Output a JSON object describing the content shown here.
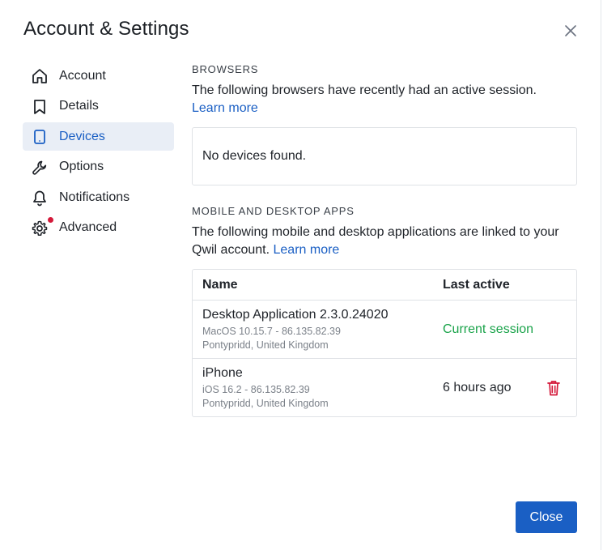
{
  "dialog": {
    "title": "Account & Settings",
    "close_icon": "close-icon"
  },
  "sidebar": {
    "items": [
      {
        "label": "Account",
        "icon": "home-icon"
      },
      {
        "label": "Details",
        "icon": "bookmark-icon"
      },
      {
        "label": "Devices",
        "icon": "tablet-icon",
        "active": true
      },
      {
        "label": "Options",
        "icon": "wrench-icon"
      },
      {
        "label": "Notifications",
        "icon": "bell-icon"
      },
      {
        "label": "Advanced",
        "icon": "gear-icon",
        "badge": true
      }
    ]
  },
  "browsers": {
    "heading": "BROWSERS",
    "description": "The following browsers have recently had an active session.",
    "learn_more": "Learn more",
    "empty_text": "No devices found."
  },
  "apps": {
    "heading": "MOBILE AND DESKTOP APPS",
    "description": "The following mobile and desktop applications are linked to your Qwil account.",
    "learn_more": "Learn more",
    "columns": {
      "name": "Name",
      "last_active": "Last active"
    },
    "rows": [
      {
        "name": "Desktop Application 2.3.0.24020",
        "os": "MacOS 10.15.7 - 86.135.82.39",
        "location": "Pontypridd, United Kingdom",
        "last_active": "Current session"
      },
      {
        "name": "iPhone",
        "os": "iOS 16.2 - 86.135.82.39",
        "location": "Pontypridd, United Kingdom",
        "last_active": "6 hours ago"
      }
    ]
  },
  "footer": {
    "close_label": "Close"
  },
  "colors": {
    "accent": "#1a5fc4",
    "success": "#1aa34a",
    "danger": "#d4193a"
  }
}
